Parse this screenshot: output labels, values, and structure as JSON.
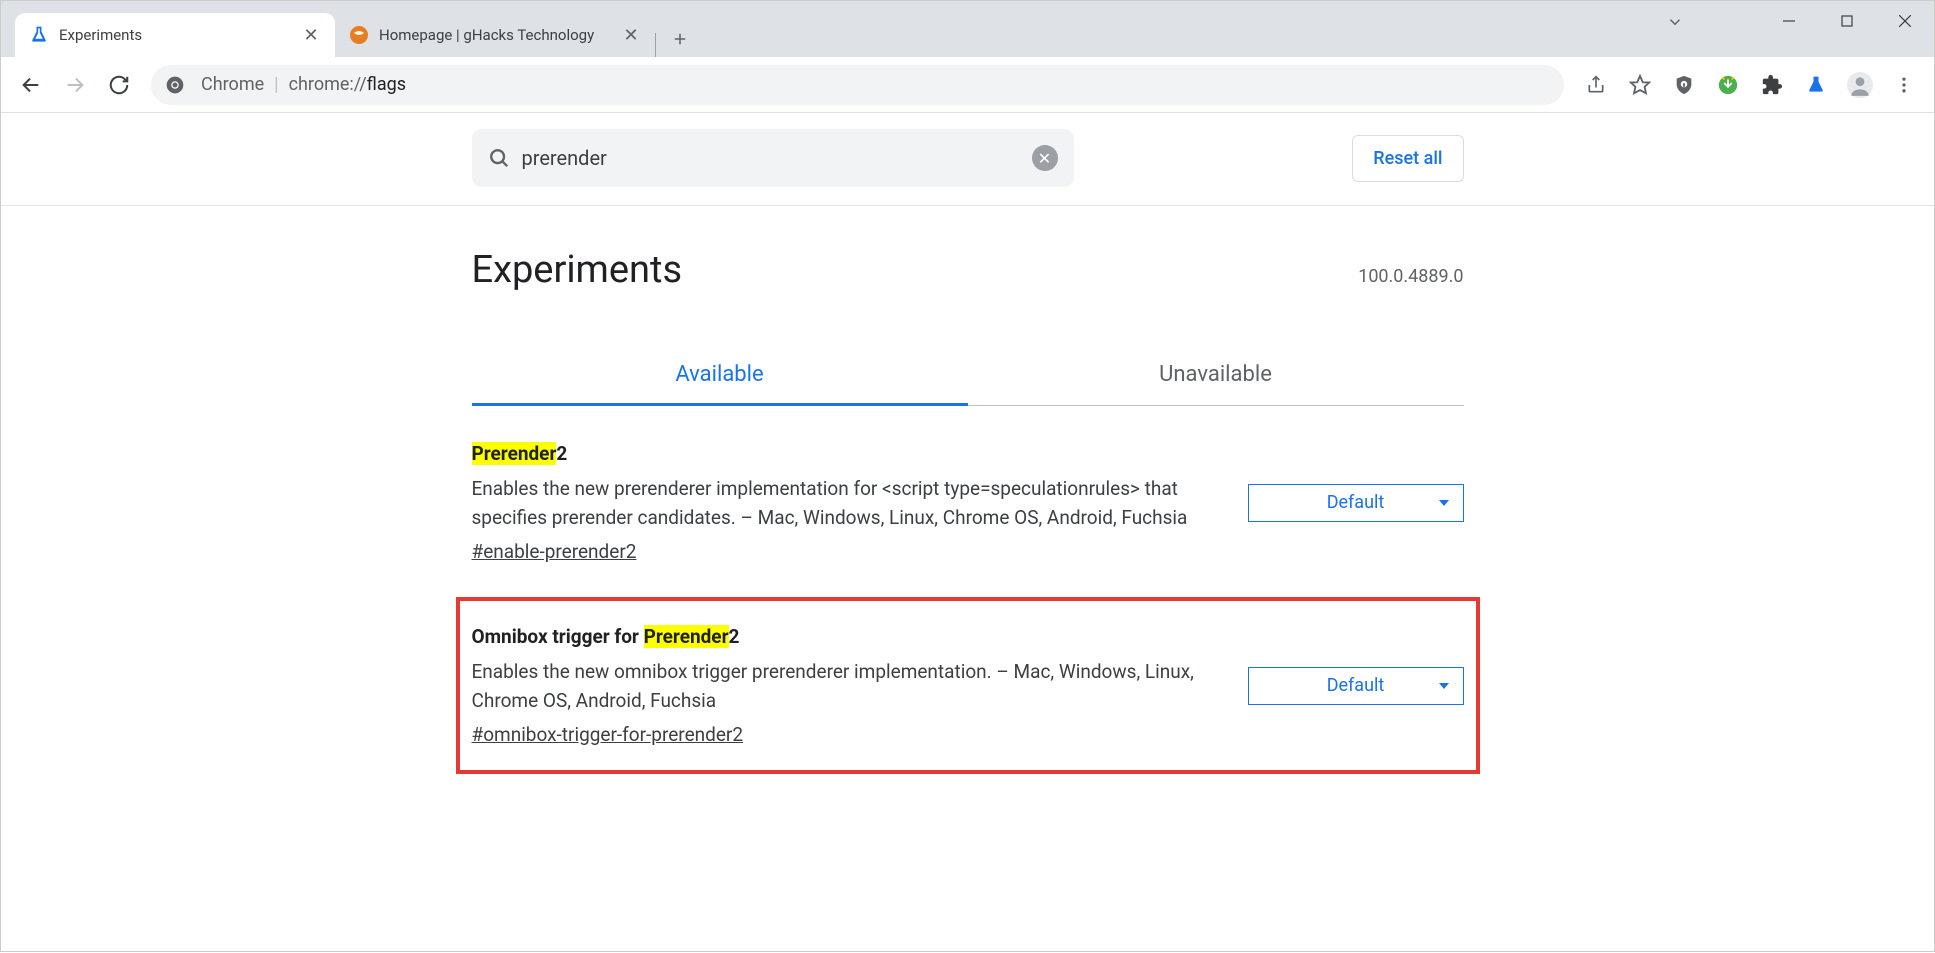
{
  "browser": {
    "tabs": [
      {
        "title": "Experiments",
        "active": true
      },
      {
        "title": "Homepage | gHacks Technology",
        "active": false
      }
    ],
    "omnibox": {
      "prefix": "Chrome",
      "scheme": "chrome://",
      "path": "flags"
    }
  },
  "page": {
    "search": {
      "value": "prerender"
    },
    "reset": "Reset all",
    "title": "Experiments",
    "version": "100.0.4889.0",
    "tabs": {
      "available": "Available",
      "unavailable": "Unavailable"
    },
    "flags": [
      {
        "title_pre": "",
        "title_hl": "Prerender",
        "title_post": "2",
        "desc": "Enables the new prerenderer implementation for <script type=speculationrules> that specifies prerender candidates. – Mac, Windows, Linux, Chrome OS, Android, Fuchsia",
        "anchor": "#enable-prerender2",
        "select": "Default",
        "boxed": false
      },
      {
        "title_pre": "Omnibox trigger for ",
        "title_hl": "Prerender",
        "title_post": "2",
        "desc": "Enables the new omnibox trigger prerenderer implementation. – Mac, Windows, Linux, Chrome OS, Android, Fuchsia",
        "anchor": "#omnibox-trigger-for-prerender2",
        "select": "Default",
        "boxed": true
      }
    ]
  }
}
